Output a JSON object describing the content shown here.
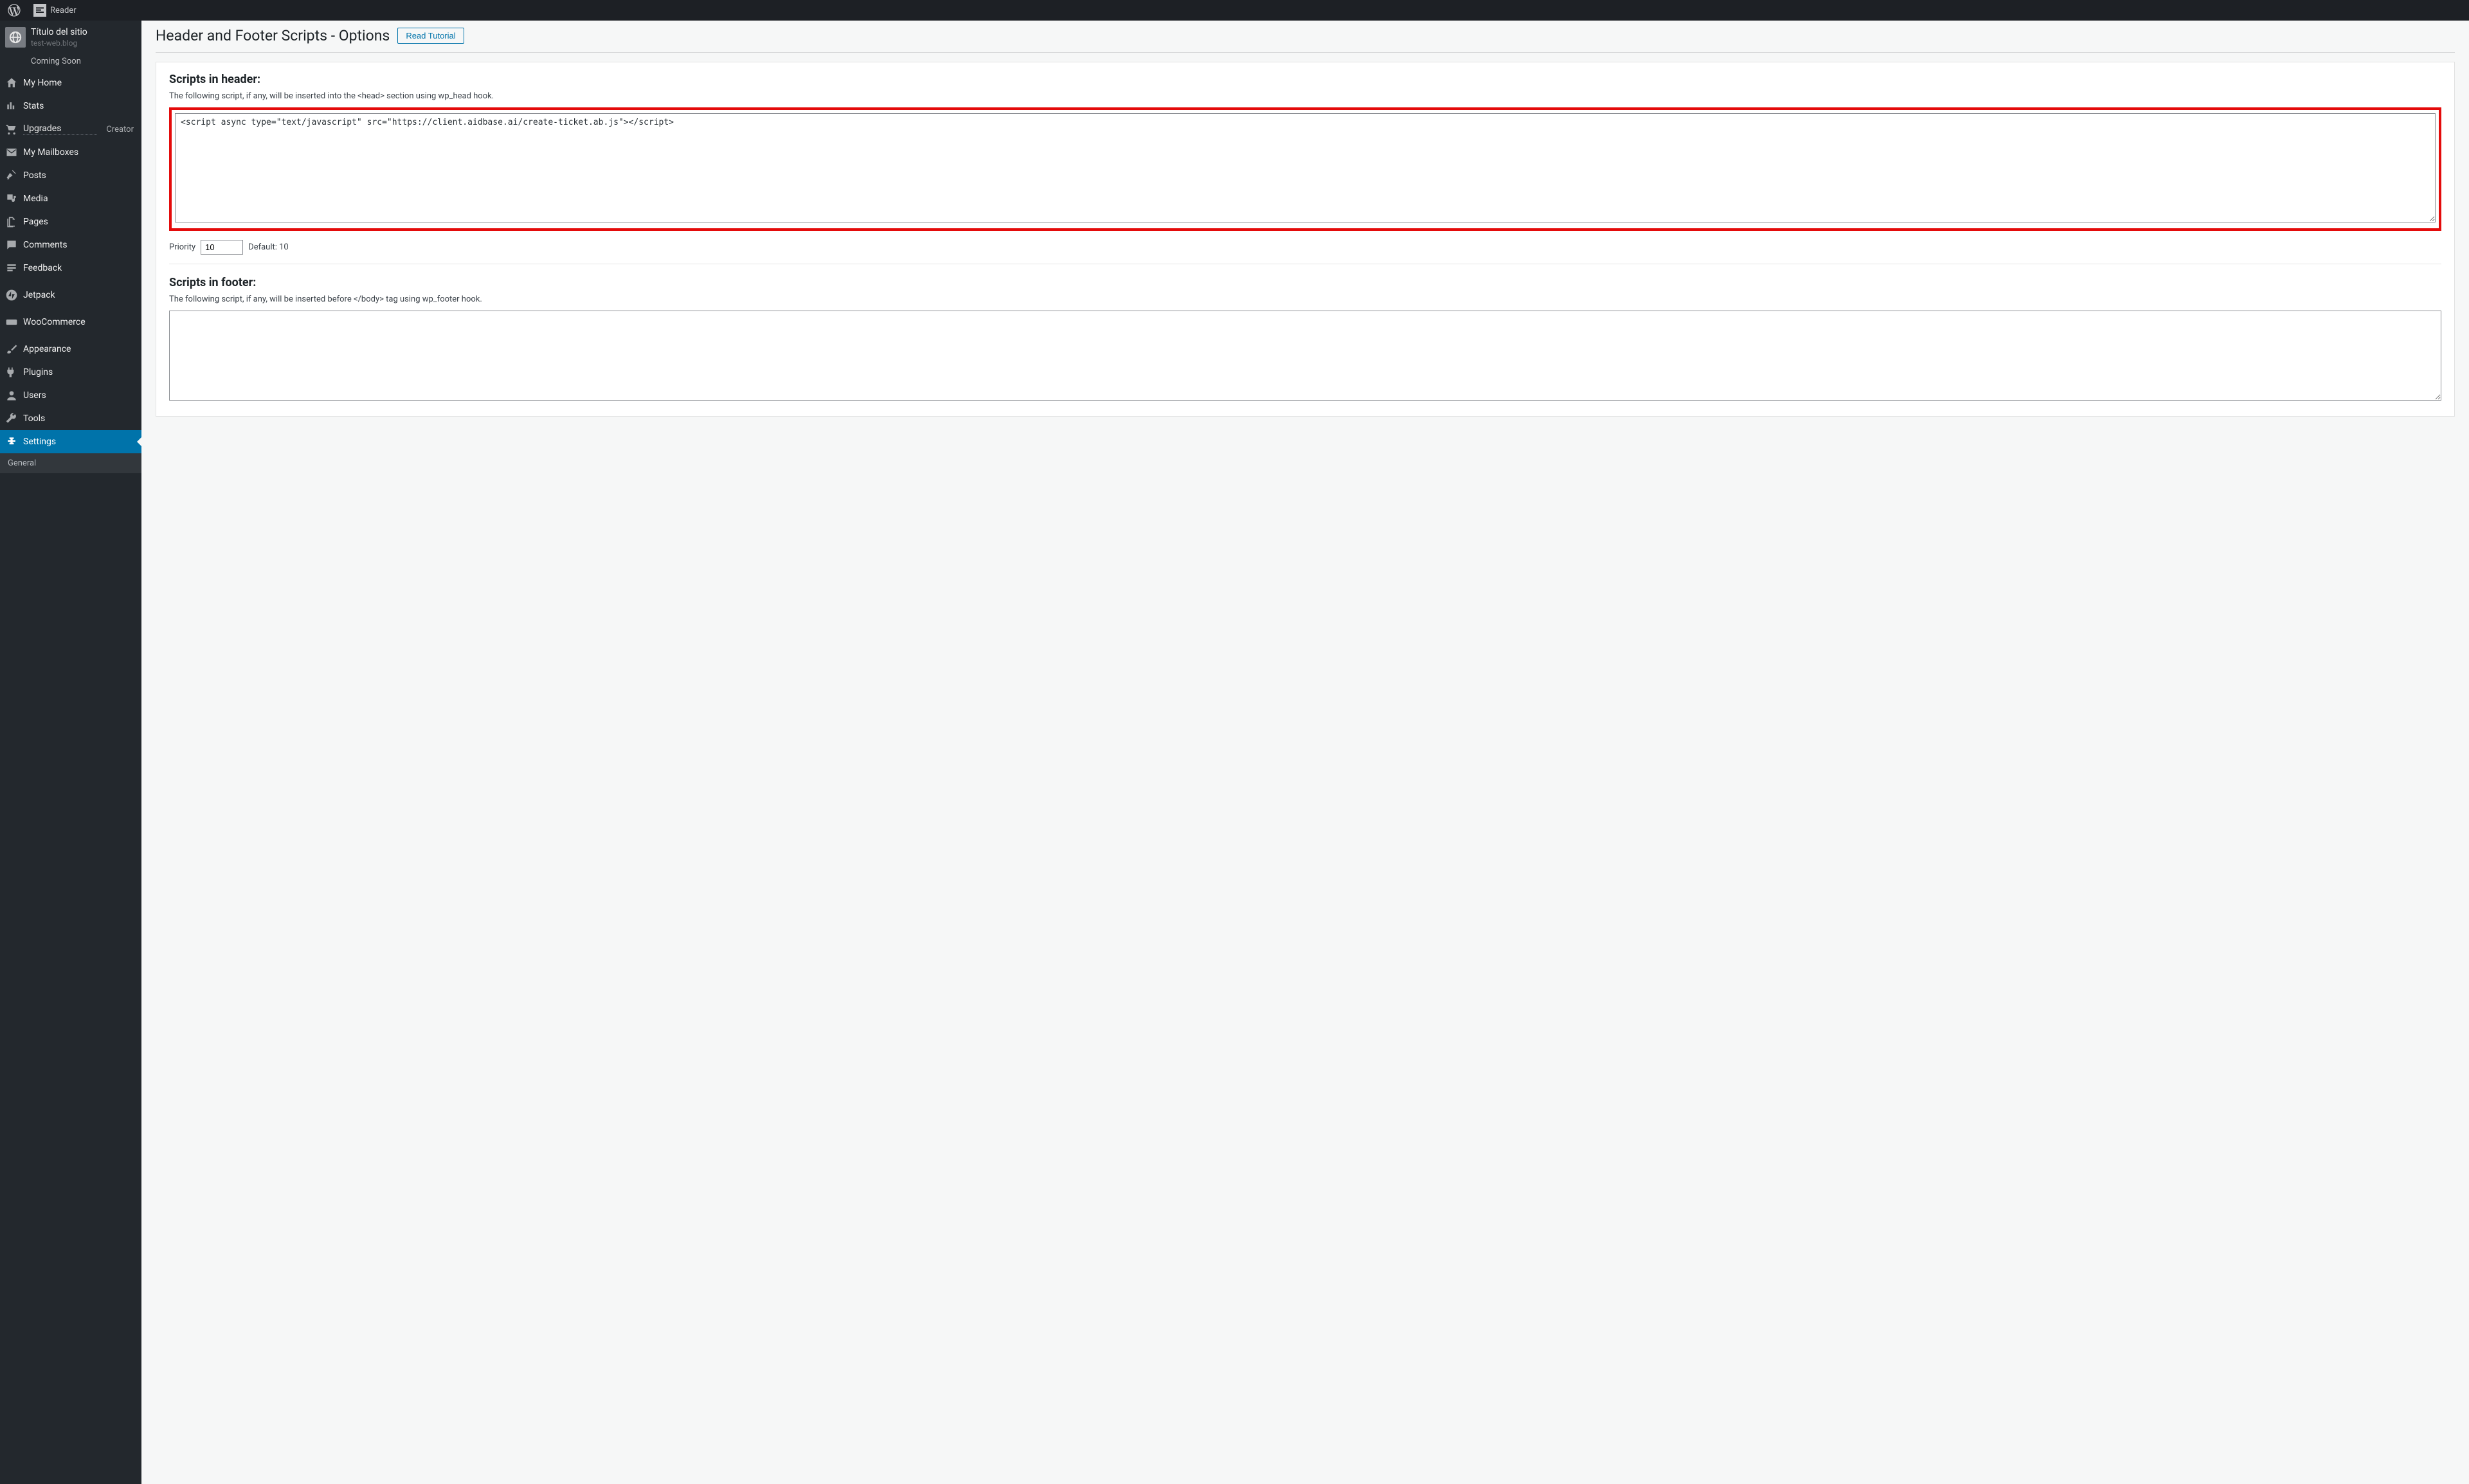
{
  "topbar": {
    "reader_label": "Reader"
  },
  "site": {
    "title": "Título del sitio",
    "url": "test-web.blog",
    "status": "Coming Soon"
  },
  "sidebar": {
    "my_home": "My Home",
    "stats": "Stats",
    "upgrades": "Upgrades",
    "upgrades_right": "Creator",
    "my_mailboxes": "My Mailboxes",
    "posts": "Posts",
    "media": "Media",
    "pages": "Pages",
    "comments": "Comments",
    "feedback": "Feedback",
    "jetpack": "Jetpack",
    "woocommerce": "WooCommerce",
    "appearance": "Appearance",
    "plugins": "Plugins",
    "users": "Users",
    "tools": "Tools",
    "settings": "Settings",
    "submenu": {
      "general": "General"
    }
  },
  "page": {
    "title": "Header and Footer Scripts - Options",
    "tutorial_button": "Read Tutorial"
  },
  "header_section": {
    "title": "Scripts in header:",
    "description": "The following script, if any, will be inserted into the <head> section using wp_head hook.",
    "textarea_value": "<script async type=\"text/javascript\" src=\"https://client.aidbase.ai/create-ticket.ab.js\"></script>",
    "priority_label": "Priority",
    "priority_value": "10",
    "priority_default": "Default: 10"
  },
  "footer_section": {
    "title": "Scripts in footer:",
    "description": "The following script, if any, will be inserted before </body> tag using wp_footer hook.",
    "textarea_value": ""
  }
}
